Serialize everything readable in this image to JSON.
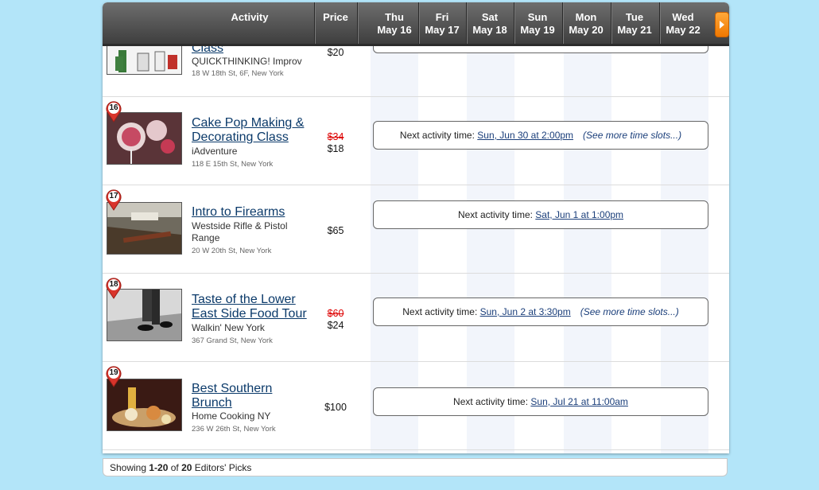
{
  "header": {
    "activity": "Activity",
    "price": "Price",
    "days": [
      {
        "dow": "Thu",
        "date": "May 16"
      },
      {
        "dow": "Fri",
        "date": "May 17"
      },
      {
        "dow": "Sat",
        "date": "May 18"
      },
      {
        "dow": "Sun",
        "date": "May 19"
      },
      {
        "dow": "Mon",
        "date": "May 20"
      },
      {
        "dow": "Tue",
        "date": "May 21"
      },
      {
        "dow": "Wed",
        "date": "May 22"
      }
    ],
    "next_icon": "right-arrow-icon"
  },
  "slot_prefix": "Next activity time: ",
  "more_label": "(See more time slots...)",
  "rows": [
    {
      "title": "Class",
      "vendor": "QUICKTHINKING! Improv",
      "address": "18 W 18th St, 6F, New York",
      "price": "$20"
    },
    {
      "num": "16",
      "title": "Cake Pop Making & Decorating Class",
      "vendor": "iAdventure",
      "address": "118 E 15th St, New York",
      "old_price": "$34",
      "price": "$18",
      "next_time": "Sun, Jun 30 at 2:00pm"
    },
    {
      "num": "17",
      "title": "Intro to Firearms",
      "vendor": "Westside Rifle & Pistol Range",
      "address": "20 W 20th St, New York",
      "price": "$65",
      "next_time": "Sat, Jun 1 at 1:00pm"
    },
    {
      "num": "18",
      "title": "Taste of the Lower East Side Food Tour",
      "vendor": "Walkin' New York",
      "address": "367 Grand St, New York",
      "old_price": "$60",
      "price": "$24",
      "next_time": "Sun, Jun 2 at 3:30pm"
    },
    {
      "num": "19",
      "title": "Best Southern Brunch",
      "vendor": "Home Cooking NY",
      "address": "236 W 26th St, New York",
      "price": "$100",
      "next_time": "Sun, Jul 21 at 11:00am"
    }
  ],
  "footer": {
    "prefix": "Showing ",
    "range": "1-20",
    "middle": " of ",
    "total": "20",
    "suffix": " Editors' Picks"
  },
  "colors": {
    "background": "#b3e5f9",
    "header": "#4a4a4a",
    "pin": "#d9342b",
    "link": "#0b3a6a",
    "old_price": "#dd0000",
    "next_button": "#f28a16"
  }
}
